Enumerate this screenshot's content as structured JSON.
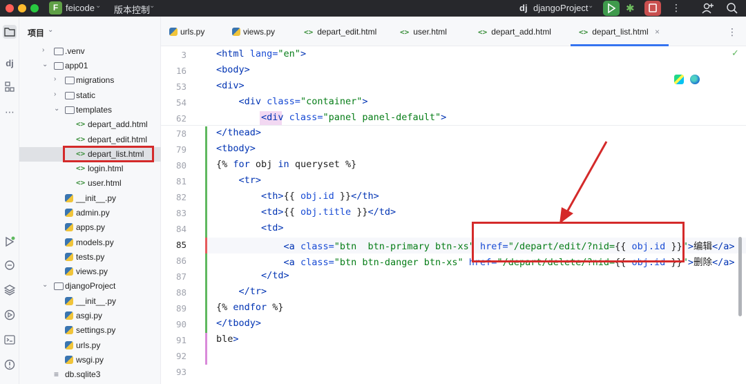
{
  "titlebar": {
    "project_initial": "F",
    "project_name": "feicode",
    "vcs_label": "版本控制",
    "run_config": "djangoProject",
    "dj_logo_text": "dj"
  },
  "project_panel": {
    "title": "项目",
    "tree": [
      {
        "label": ".venv",
        "type": "folder"
      },
      {
        "label": "app01",
        "type": "folder"
      },
      {
        "label": "migrations",
        "type": "folder"
      },
      {
        "label": "static",
        "type": "folder"
      },
      {
        "label": "templates",
        "type": "folder"
      },
      {
        "label": "depart_add.html",
        "type": "html"
      },
      {
        "label": "depart_edit.html",
        "type": "html"
      },
      {
        "label": "depart_list.html",
        "type": "html"
      },
      {
        "label": "login.html",
        "type": "html"
      },
      {
        "label": "user.html",
        "type": "html"
      },
      {
        "label": "__init__.py",
        "type": "py"
      },
      {
        "label": "admin.py",
        "type": "py"
      },
      {
        "label": "apps.py",
        "type": "py"
      },
      {
        "label": "models.py",
        "type": "py"
      },
      {
        "label": "tests.py",
        "type": "py"
      },
      {
        "label": "views.py",
        "type": "py"
      },
      {
        "label": "djangoProject",
        "type": "folder"
      },
      {
        "label": "__init__.py",
        "type": "py"
      },
      {
        "label": "asgi.py",
        "type": "py"
      },
      {
        "label": "settings.py",
        "type": "py"
      },
      {
        "label": "urls.py",
        "type": "py"
      },
      {
        "label": "wsgi.py",
        "type": "py"
      },
      {
        "label": "db.sqlite3",
        "type": "db"
      }
    ]
  },
  "tabs": [
    {
      "label": "urls.py",
      "type": "py"
    },
    {
      "label": "views.py",
      "type": "py"
    },
    {
      "label": "depart_edit.html",
      "type": "html"
    },
    {
      "label": "user.html",
      "type": "html"
    },
    {
      "label": "depart_add.html",
      "type": "html"
    },
    {
      "label": "depart_list.html",
      "type": "html",
      "active": true
    }
  ],
  "sticky_lines": [
    {
      "num": "3",
      "code": "<html lang=\"en\">"
    },
    {
      "num": "16",
      "code": "<body>"
    },
    {
      "num": "53",
      "code": "<div>"
    },
    {
      "num": "54",
      "code": "    <div class=\"container\">"
    },
    {
      "num": "62",
      "code": "        <div class=\"panel panel-default\">"
    }
  ],
  "code_lines": [
    {
      "num": "78",
      "code": "</thead>"
    },
    {
      "num": "79",
      "code": "<tbody>"
    },
    {
      "num": "80",
      "code": "{% for obj in queryset %}"
    },
    {
      "num": "81",
      "code": "    <tr>"
    },
    {
      "num": "82",
      "code": "        <th>{{ obj.id }}</th>"
    },
    {
      "num": "83",
      "code": "        <td>{{ obj.title }}</td>"
    },
    {
      "num": "84",
      "code": "        <td>"
    },
    {
      "num": "85",
      "code": "            <a class=\"btn  btn-primary btn-xs\" href=\"/depart/edit/?nid={{ obj.id }}\">编辑</a>"
    },
    {
      "num": "86",
      "code": "            <a class=\"btn btn-danger btn-xs\" href=\"/depart/delete/?nid={{ obj.id }}\">删除</a>"
    },
    {
      "num": "87",
      "code": "        </td>"
    },
    {
      "num": "88",
      "code": "    </tr>"
    },
    {
      "num": "89",
      "code": "{% endfor %}"
    },
    {
      "num": "90",
      "code": "</tbody>"
    },
    {
      "num": "91",
      "code": "ble>"
    },
    {
      "num": "92",
      "code": ""
    },
    {
      "num": "93",
      "code": ""
    }
  ],
  "colors": {
    "accent": "#3574f0",
    "annotation": "#d42a2a",
    "titlebar_bg": "#27282c"
  }
}
